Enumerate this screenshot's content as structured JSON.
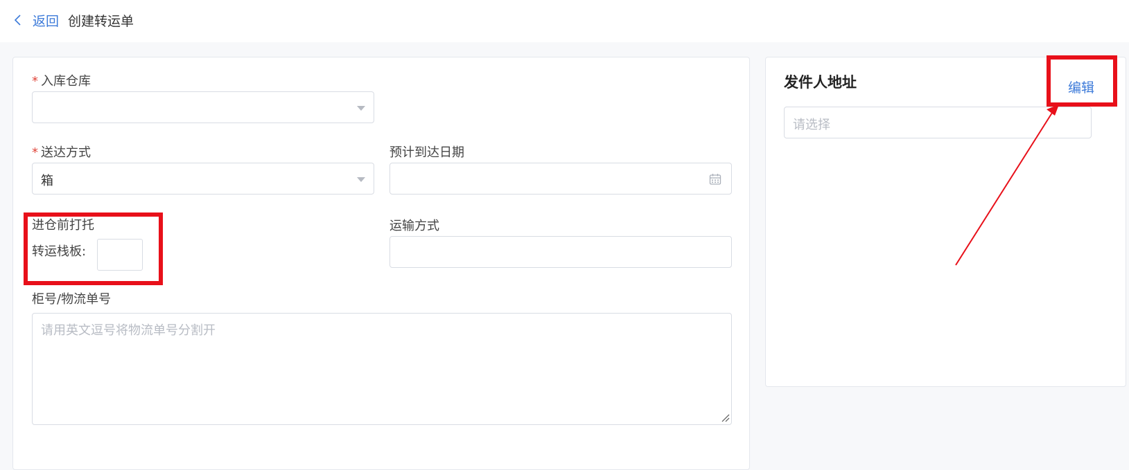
{
  "header": {
    "back_label": "返回",
    "title": "创建转运单"
  },
  "form": {
    "warehouse": {
      "label": "入库仓库",
      "required_mark": "*",
      "value": ""
    },
    "delivery": {
      "label": "送达方式",
      "required_mark": "*",
      "value": "箱"
    },
    "arrival_date": {
      "label": "预计到达日期",
      "value": ""
    },
    "pallet": {
      "label": "进仓前打托",
      "sub_label": "转运栈板:",
      "value": ""
    },
    "transport": {
      "label": "运输方式",
      "value": ""
    },
    "tracking": {
      "label": "柜号/物流单号",
      "placeholder": "请用英文逗号将物流单号分割开"
    }
  },
  "sender": {
    "title": "发件人地址",
    "edit_label": "编辑",
    "placeholder": "请选择"
  },
  "colors": {
    "accent": "#3c7ad9",
    "required": "#e0463b",
    "highlight": "#e8101a"
  },
  "icons": [
    "chevron-left-icon",
    "dropdown-caret-icon",
    "calendar-icon",
    "resize-grip-icon",
    "annotation-arrow"
  ]
}
